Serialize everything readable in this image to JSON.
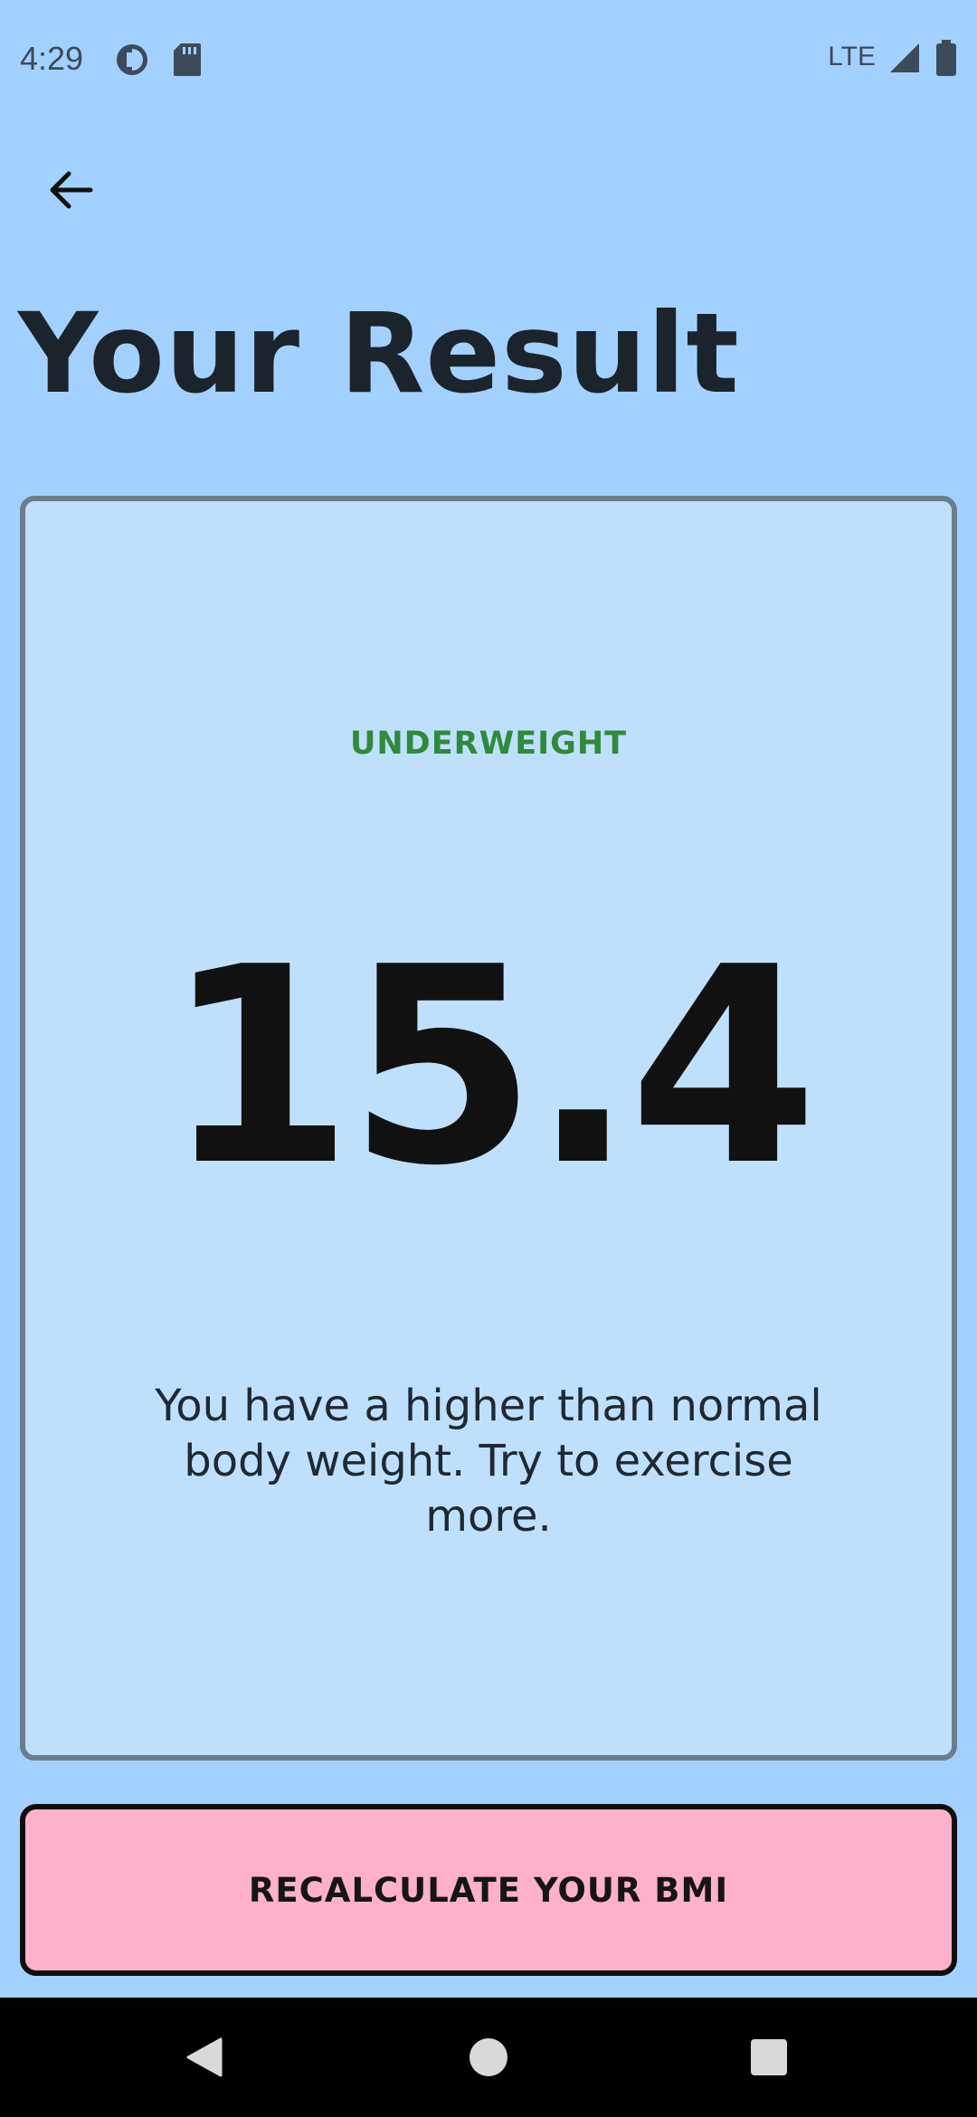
{
  "status_bar": {
    "time": "4:29",
    "network": "LTE",
    "icons": [
      "data-saver-icon",
      "sd-card-icon",
      "signal-icon",
      "battery-icon"
    ]
  },
  "header": {
    "back_icon": "arrow-left-icon",
    "title": "Your Result"
  },
  "result": {
    "category": "UNDERWEIGHT",
    "category_color": "#2f8a3c",
    "bmi": "15.4",
    "message": "You have a higher than normal body weight. Try to exercise more."
  },
  "actions": {
    "recalculate_label": "RECALCULATE YOUR BMI"
  },
  "colors": {
    "background": "#a3d1ff",
    "card_background": "#bfe0fd",
    "button_background": "#ffb0cb"
  },
  "nav": {
    "icons": [
      "back-icon",
      "home-icon",
      "recents-icon"
    ]
  }
}
